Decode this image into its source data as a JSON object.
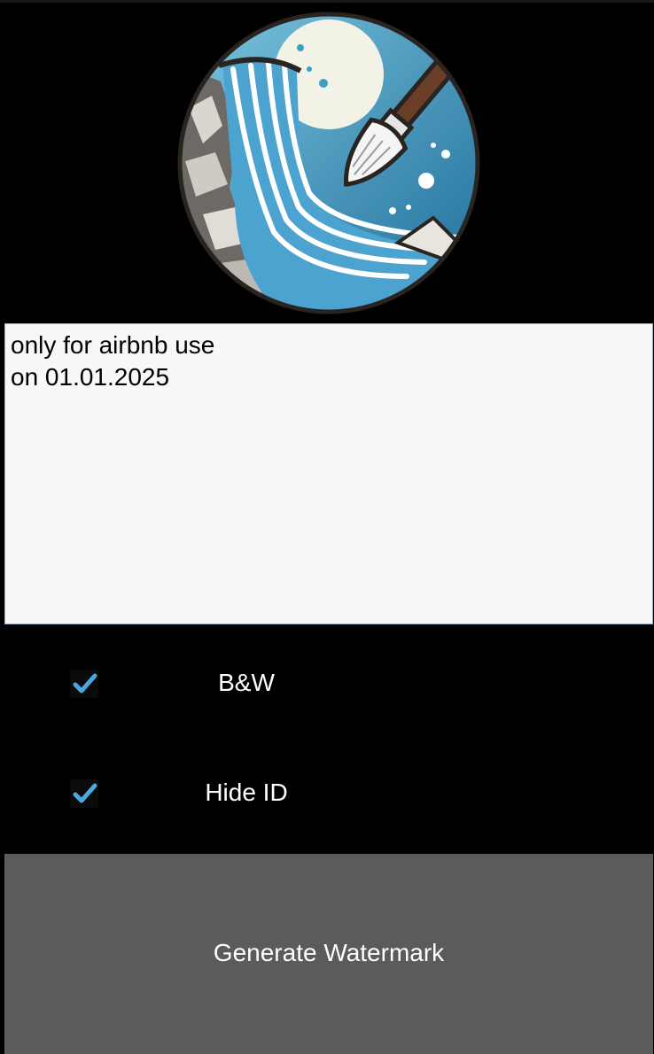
{
  "app": {
    "logo_icon": "waterfall-paintbrush-logo"
  },
  "watermark_text": {
    "value": "only for airbnb use\non 01.01.2025"
  },
  "options": [
    {
      "label": "B&W",
      "checked": true
    },
    {
      "label": "Hide ID",
      "checked": true
    }
  ],
  "generate": {
    "label": "Generate Watermark"
  },
  "colors": {
    "background": "#000000",
    "text_area_bg": "#f8f8f8",
    "checkmark": "#4aa8e0",
    "button_bg": "#5b5b5b",
    "button_text": "#ffffff"
  }
}
